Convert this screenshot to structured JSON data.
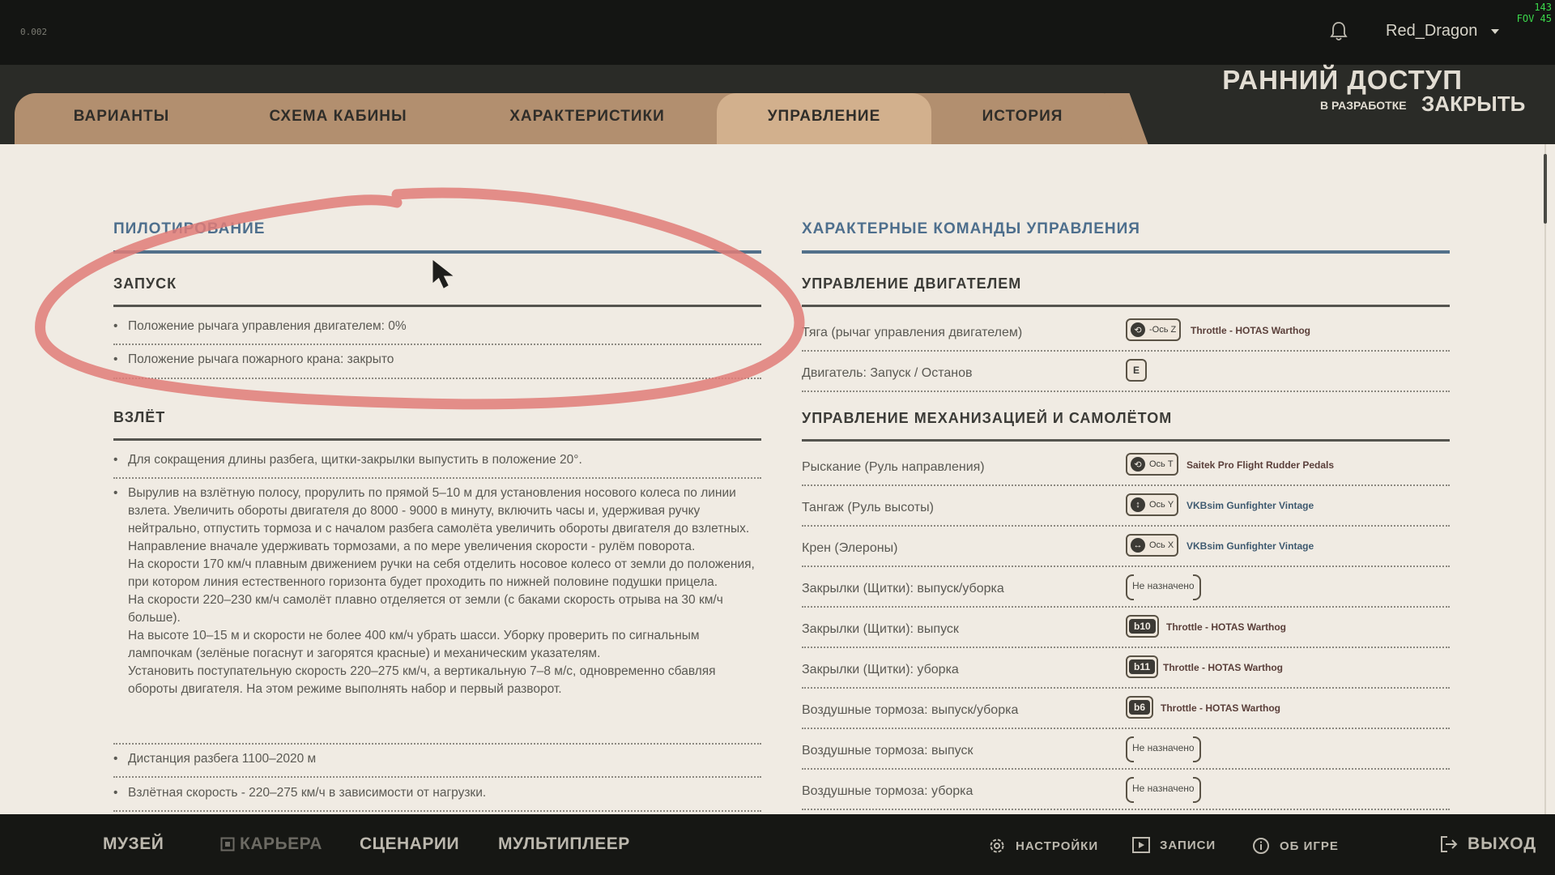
{
  "topbar": {
    "version": "0.002",
    "username": "Red_Dragon",
    "fps_line1": "143",
    "fps_line2": "FOV 45"
  },
  "tabs": [
    {
      "label": "ВАРИАНТЫ"
    },
    {
      "label": "СХЕМА КАБИНЫ"
    },
    {
      "label": "ХАРАКТЕРИСТИКИ"
    },
    {
      "label": "УПРАВЛЕНИЕ",
      "active": true
    },
    {
      "label": "ИСТОРИЯ"
    }
  ],
  "header": {
    "early_access": "РАННИЙ ДОСТУП",
    "in_development": "В РАЗРАБОТКЕ",
    "close": "ЗАКРЫТЬ"
  },
  "left": {
    "title": "ПИЛОТИРОВАНИЕ",
    "launch": {
      "title": "ЗАПУСК",
      "items": [
        "Положение рычага управления двигателем: 0%",
        "Положение рычага пожарного крана: закрыто"
      ]
    },
    "takeoff": {
      "title": "ВЗЛЁТ",
      "items": [
        "Для сокращения длины разбега, щитки-закрылки выпустить в положение 20°.",
        "Вырулив на взлётную полосу, прорулить по прямой 5–10 м для установления носового колеса по линии взлета. Увеличить обороты двигателя до 8000 - 9000 в минуту, включить часы и, удерживая ручку нейтрально, отпустить тормоза и с началом разбега самолёта увеличить обороты двигателя до взлетных. Направление вначале удерживать тормозами, а по мере увеличения скорости - рулём поворота.\nНа скорости 170 км/ч плавным движением ручки на себя отделить носовое колесо от земли до положения, при котором линия естественного горизонта будет проходить по нижней половине подушки прицела.\nНа скорости 220–230 км/ч самолёт плавно отделяется от земли (с баками скорость отрыва на 30 км/ч больше).\nНа высоте 10–15 м и скорости не более 400 км/ч убрать шасси. Уборку проверить по сигнальным лампочкам (зелёные погаснут и загорятся красные) и механическим указателям.\nУстановить поступательную скорость 220–275 км/ч, а вертикальную 7–8 м/с, одновременно сбавляя обороты двигателя. На этом режиме выполнять набор и первый разворот.",
        "Дистанция разбега 1100–2020 м",
        "Взлётная скорость - 220–275 км/ч в зависимости от нагрузки."
      ]
    }
  },
  "right": {
    "title": "ХАРАКТЕРНЫЕ КОМАНДЫ УПРАВЛЕНИЯ",
    "engine": {
      "title": "УПРАВЛЕНИЕ ДВИГАТЕЛЕМ",
      "rows": [
        {
          "label": "Тяга (рычаг управления двигателем)",
          "binding": "-Ось Z",
          "device": "Throttle - HOTAS Warthog"
        },
        {
          "label": "Двигатель: Запуск / Останов",
          "binding": "E",
          "device": ""
        }
      ]
    },
    "mech": {
      "title": "УПРАВЛЕНИЕ МЕХАНИЗАЦИЕЙ И САМОЛЁТОМ",
      "rows": [
        {
          "label": "Рыскание (Руль направления)",
          "binding": "Ось T",
          "device": "Saitek Pro Flight Rudder Pedals"
        },
        {
          "label": "Тангаж (Руль высоты)",
          "binding": "Ось Y",
          "device": "VKBsim Gunfighter Vintage"
        },
        {
          "label": "Крен (Элероны)",
          "binding": "Ось X",
          "device": "VKBsim Gunfighter Vintage"
        },
        {
          "label": "Закрылки (Щитки): выпуск/уборка",
          "binding": "Не назначено",
          "device": ""
        },
        {
          "label": "Закрылки (Щитки): выпуск",
          "binding": "b10",
          "device": "Throttle - HOTAS Warthog"
        },
        {
          "label": "Закрылки (Щитки): уборка",
          "binding": "b11",
          "device": "Throttle - HOTAS Warthog"
        },
        {
          "label": "Воздушные тормоза: выпуск/уборка",
          "binding": "b6",
          "device": "Throttle - HOTAS Warthog"
        },
        {
          "label": "Воздушные тормоза: выпуск",
          "binding": "Не назначено",
          "device": ""
        },
        {
          "label": "Воздушные тормоза: уборка",
          "binding": "Не назначено",
          "device": ""
        }
      ]
    }
  },
  "bottom": {
    "museum": "МУЗЕЙ",
    "career": "КАРЬЕРА",
    "scenarios": "СЦЕНАРИИ",
    "multiplayer": "МУЛЬТИПЛЕЕР",
    "settings": "НАСТРОЙКИ",
    "records": "ЗАПИСИ",
    "about": "ОБ ИГРЕ",
    "exit": "ВЫХОД"
  },
  "colors": {
    "accent_blue": "#4e6f8d",
    "tab_bg": "#b28f6f",
    "tab_active": "#d2b08d",
    "annotation_red": "#e07c78"
  }
}
